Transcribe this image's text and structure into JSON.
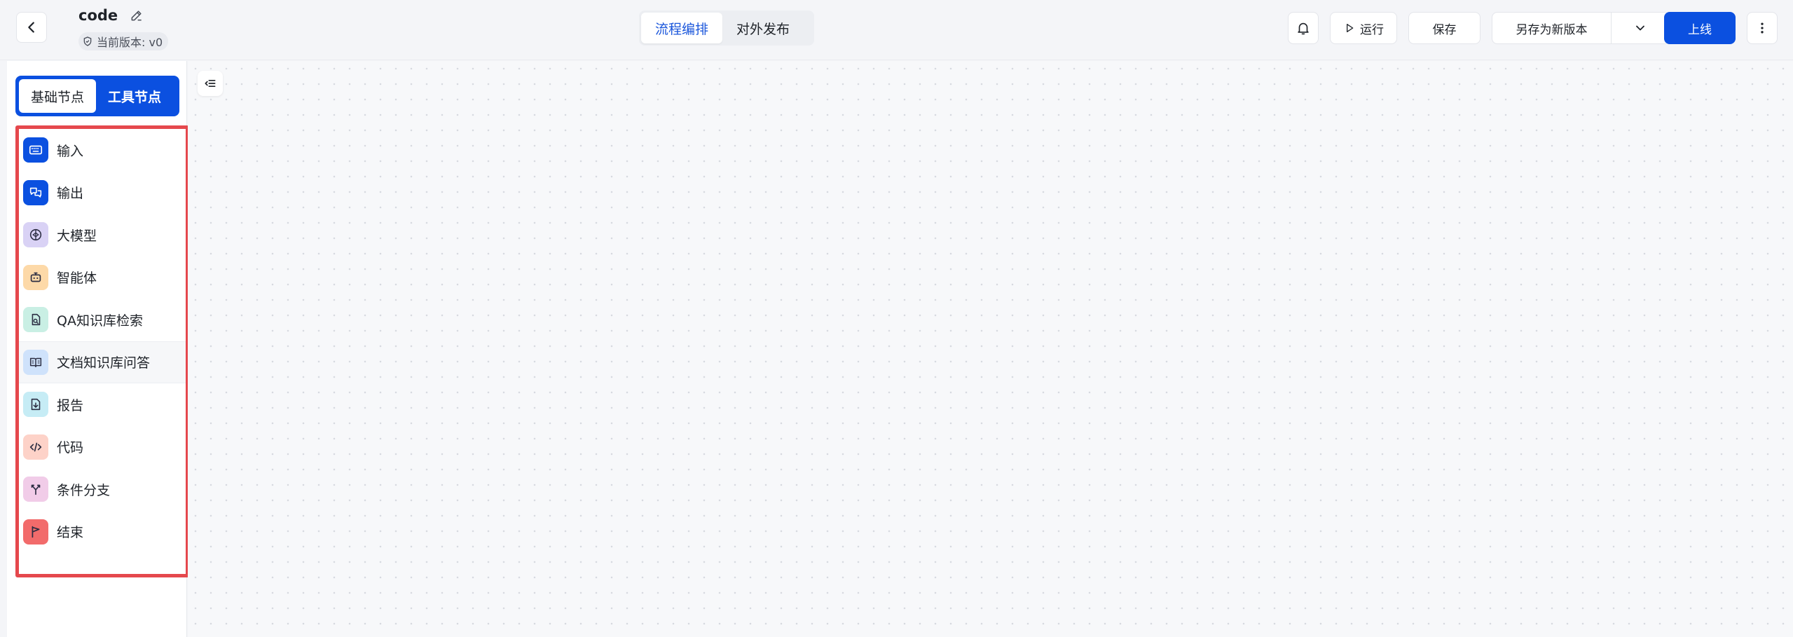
{
  "header": {
    "title": "code",
    "version_label": "当前版本: v0",
    "tabs": [
      {
        "label": "流程编排",
        "active": true
      },
      {
        "label": "对外发布",
        "active": false
      }
    ],
    "run_label": "运行",
    "save_label": "保存",
    "save_as_label": "另存为新版本",
    "publish_label": "上线"
  },
  "sidebar": {
    "tabs": [
      {
        "label": "基础节点",
        "active": true
      },
      {
        "label": "工具节点",
        "active": false
      }
    ],
    "nodes": [
      {
        "label": "输入",
        "icon": "keyboard-icon",
        "color": "#0b50e0"
      },
      {
        "label": "输出",
        "icon": "chat-output-icon",
        "color": "#0b50e0"
      },
      {
        "label": "大模型",
        "icon": "brain-icon",
        "color": "#d9d2f5"
      },
      {
        "label": "智能体",
        "icon": "robot-icon",
        "color": "#fdd9a8"
      },
      {
        "label": "QA知识库检索",
        "icon": "doc-search-icon",
        "color": "#c9efe4"
      },
      {
        "label": "文档知识库问答",
        "icon": "book-icon",
        "color": "#cfe2fb"
      },
      {
        "label": "报告",
        "icon": "report-download-icon",
        "color": "#c6ecf5"
      },
      {
        "label": "代码",
        "icon": "code-icon",
        "color": "#fdd2c8"
      },
      {
        "label": "条件分支",
        "icon": "branch-icon",
        "color": "#f1cce8"
      },
      {
        "label": "结束",
        "icon": "flag-icon",
        "color": "#f26b6b"
      }
    ]
  },
  "colors": {
    "primary": "#0b50e0",
    "highlight_border": "#e5484d"
  }
}
